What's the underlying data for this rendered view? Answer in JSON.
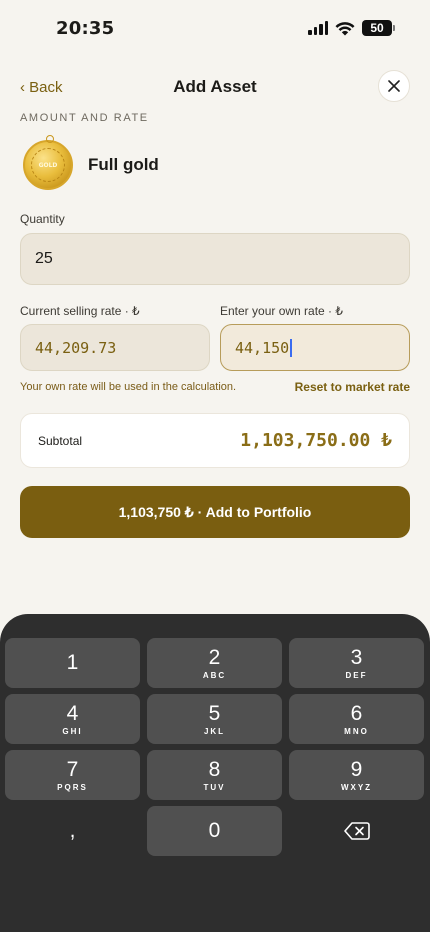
{
  "status_bar": {
    "time": "20:35",
    "battery": "50"
  },
  "nav": {
    "back_label": "‹ Back",
    "title": "Add Asset"
  },
  "section_label": "AMOUNT AND RATE",
  "asset": {
    "name": "Full gold",
    "coin_text": "GOLD"
  },
  "quantity": {
    "label": "Quantity",
    "value": "25"
  },
  "current_rate": {
    "label": "Current selling rate · ₺",
    "value": "44,209.73"
  },
  "own_rate": {
    "label": "Enter your own rate · ₺",
    "value": "44,150"
  },
  "hint": "Your own rate will be used in the calculation.",
  "reset_label": "Reset to market rate",
  "subtotal": {
    "label": "Subtotal",
    "value": "1,103,750.00 ₺"
  },
  "add_button_label": "1,103,750 ₺ · Add to Portfolio",
  "keypad": {
    "keys": [
      {
        "digit": "1",
        "letters": ""
      },
      {
        "digit": "2",
        "letters": "ABC"
      },
      {
        "digit": "3",
        "letters": "DEF"
      },
      {
        "digit": "4",
        "letters": "GHI"
      },
      {
        "digit": "5",
        "letters": "JKL"
      },
      {
        "digit": "6",
        "letters": "MNO"
      },
      {
        "digit": "7",
        "letters": "PQRS"
      },
      {
        "digit": "8",
        "letters": "TUV"
      },
      {
        "digit": "9",
        "letters": "WXYZ"
      }
    ],
    "comma": ",",
    "zero": "0"
  },
  "colors": {
    "accent": "#7a5e10",
    "rate_text": "#7a6011",
    "keyboard_bg": "#2e2e2e"
  }
}
